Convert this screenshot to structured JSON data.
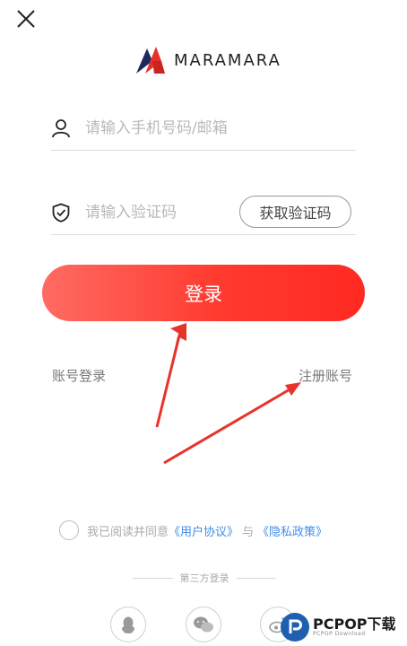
{
  "header": {
    "close_icon": "close-icon",
    "brand": "MARAMARA"
  },
  "form": {
    "phone_placeholder": "请输入手机号码/邮箱",
    "code_placeholder": "请输入验证码",
    "get_code_label": "获取验证码",
    "login_label": "登录",
    "phone_icon": "user-icon",
    "code_icon": "shield-icon"
  },
  "links": {
    "account_login": "账号登录",
    "register": "注册账号"
  },
  "agreement": {
    "prefix": "我已阅读并同意",
    "user_agreement": "《用户协议》",
    "and": "与",
    "privacy_policy": "《隐私政策》"
  },
  "third_party": {
    "title": "第三方登录",
    "providers": [
      "qq-icon",
      "wechat-icon",
      "weibo-icon"
    ]
  },
  "watermark": {
    "main": "PCPOP下载",
    "sub": "PCPOP Download"
  },
  "colors": {
    "accent_start": "#ff6b62",
    "accent_end": "#ff2a22",
    "link_blue": "#3f8ee8",
    "arrow_red": "#e8332b"
  }
}
